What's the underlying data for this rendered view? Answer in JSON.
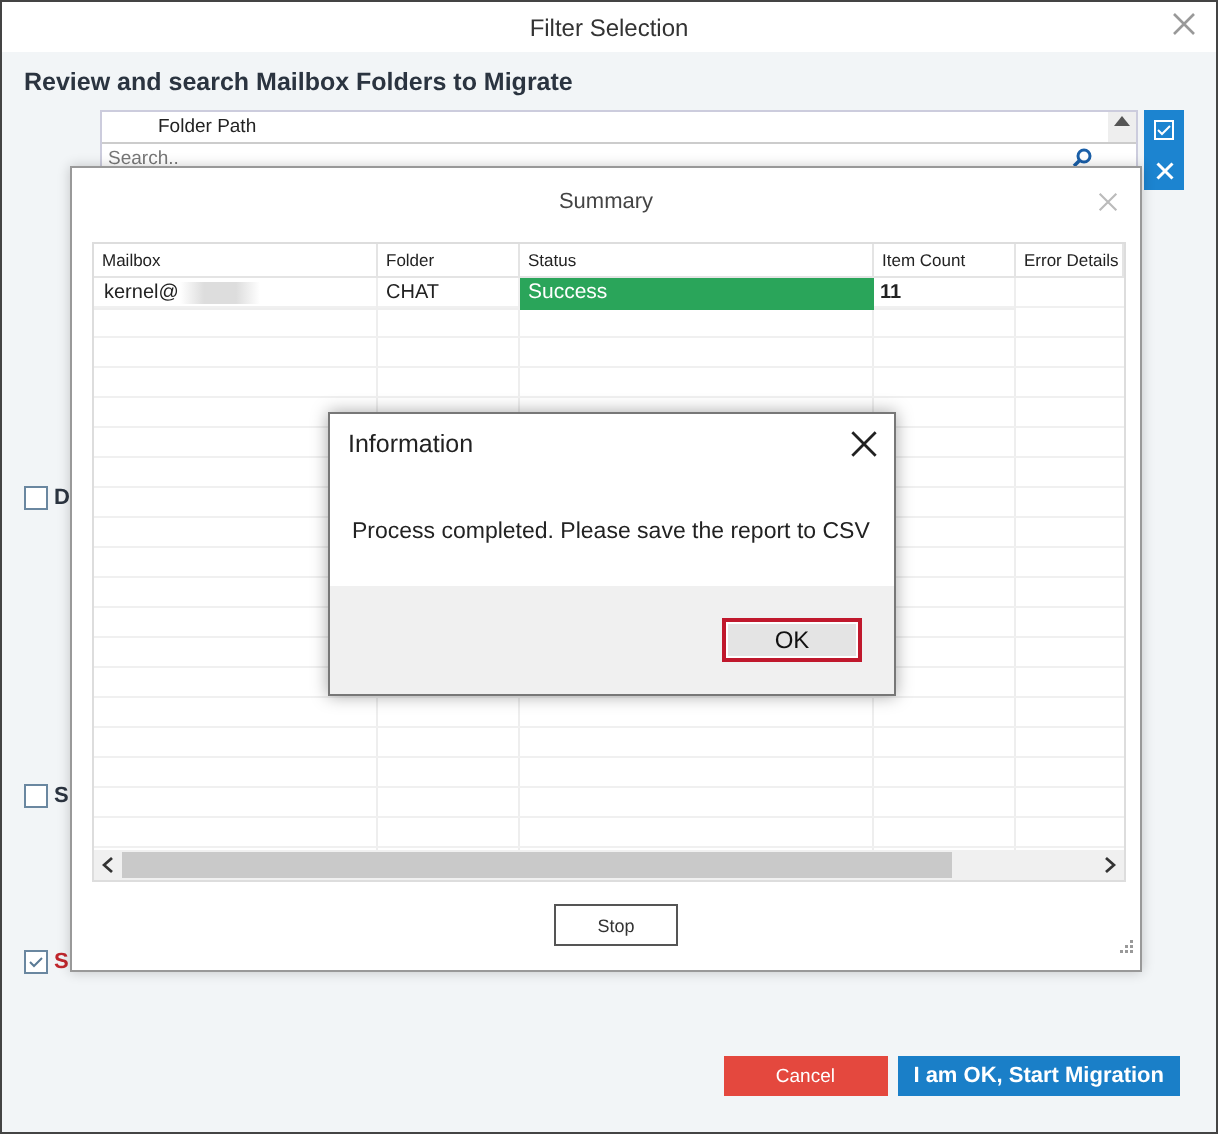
{
  "window": {
    "title": "Filter Selection"
  },
  "heading": "Review and search Mailbox Folders to Migrate",
  "folder_grid": {
    "columns": [
      "Folder Path"
    ],
    "search": {
      "placeholder": "Search.."
    }
  },
  "options": [
    {
      "label": "D",
      "checked": false,
      "kind": "normal"
    },
    {
      "label": "S",
      "checked": false,
      "kind": "normal"
    },
    {
      "label": "S",
      "checked": true,
      "kind": "warning"
    }
  ],
  "summary": {
    "title": "Summary",
    "columns": [
      "Mailbox",
      "Folder",
      "Status",
      "Item Count",
      "Error Details"
    ],
    "rows": [
      {
        "mailbox": "kernel@",
        "redacted": true,
        "folder": "CHAT",
        "status": "Success",
        "item_count": "11"
      }
    ],
    "buttons": [
      "Stop"
    ]
  },
  "information": {
    "title": "Information",
    "message": "Process completed. Please save the report to CSV",
    "buttons": [
      {
        "label": "OK",
        "focused": true
      }
    ]
  },
  "footer_buttons": [
    {
      "label": "Cancel",
      "kind": "cancel"
    },
    {
      "label": "I am OK, Start Migration",
      "kind": "primary"
    }
  ]
}
